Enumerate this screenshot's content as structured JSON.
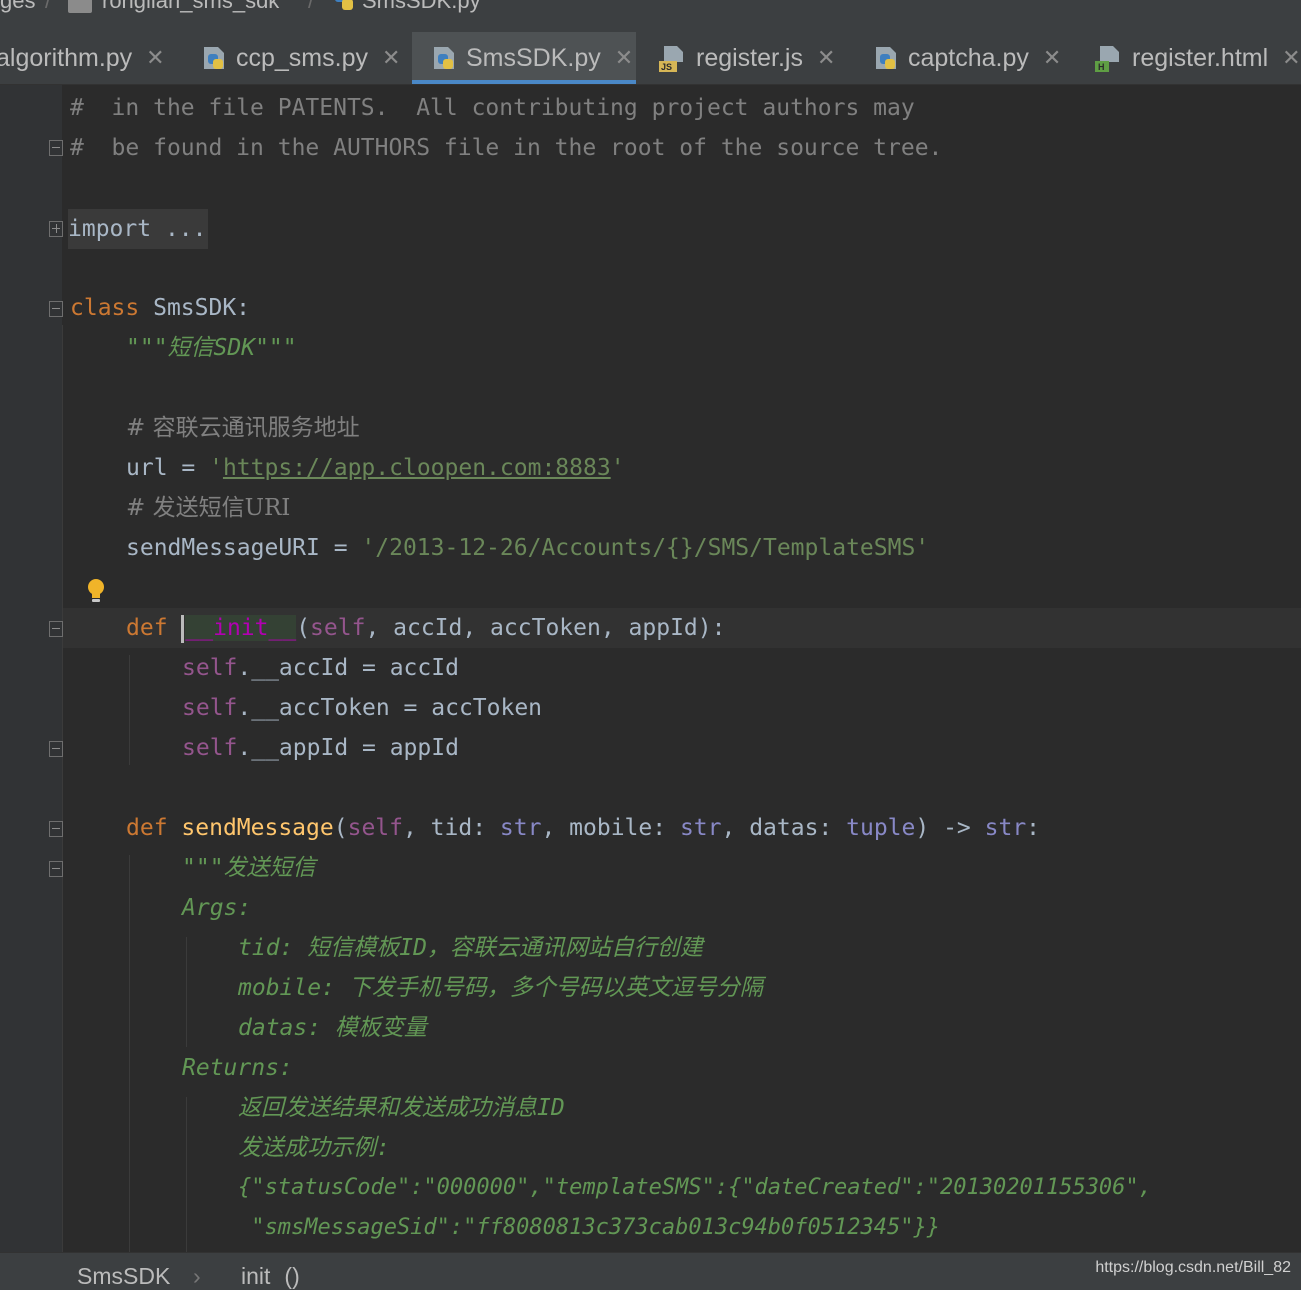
{
  "breadcrumb": {
    "items": [
      "ges",
      "ronglian_sms_sdk",
      "SmsSDK.py"
    ]
  },
  "tabs": [
    {
      "label": "algorithm.py",
      "icon": "python-file-icon",
      "active": false
    },
    {
      "label": "ccp_sms.py",
      "icon": "python-file-icon",
      "active": false
    },
    {
      "label": "SmsSDK.py",
      "icon": "python-file-icon",
      "active": true
    },
    {
      "label": "register.js",
      "icon": "javascript-file-icon",
      "active": false
    },
    {
      "label": "captcha.py",
      "icon": "python-file-icon",
      "active": false
    },
    {
      "label": "register.html",
      "icon": "html-file-icon",
      "active": false
    }
  ],
  "code": {
    "l1_hash": "#",
    "l1_text": "  in the file PATENTS.  All contributing project authors may",
    "l2_hash": "#",
    "l2_text": "  be found in the AUTHORS file in the root of the source tree.",
    "import_kw": "import",
    "import_dots": " ...",
    "class_kw": "class",
    "class_name": " SmsSDK:",
    "class_doc": "\"\"\"短信SDK\"\"\"",
    "comment_url": "# 容联云通讯服务地址",
    "url_name": "url",
    "url_eq": " = ",
    "url_q1": "'",
    "url_value": "https://app.cloopen.com:8883",
    "url_q2": "'",
    "comment_uri": "# 发送短信URI",
    "uri_name": "sendMessageURI",
    "uri_eq": " = ",
    "uri_value": "'/2013-12-26/Accounts/{}/SMS/TemplateSMS'",
    "def_kw": "def",
    "init_name": "__init__",
    "init_open": "(",
    "init_self": "self",
    "init_params": ", accId, accToken, appId):",
    "self1": "self",
    "assign1": ".__accId = accId",
    "self2": "self",
    "assign2": ".__accToken = accToken",
    "self3": "self",
    "assign3": ".__appId = appId",
    "def2_kw": "def",
    "send_name": "sendMessage",
    "send_open": "(",
    "send_self": "self",
    "send_p1": ", tid: ",
    "send_t1": "str",
    "send_p2": ", mobile: ",
    "send_t2": "str",
    "send_p3": ", datas: ",
    "send_t3": "tuple",
    "send_arrow": ") -> ",
    "send_t4": "str",
    "send_colon": ":",
    "doc1": "\"\"\"发送短信",
    "doc2": "Args:",
    "doc3": "tid: 短信模板ID，容联云通讯网站自行创建",
    "doc4": "mobile: 下发手机号码，多个号码以英文逗号分隔",
    "doc5": "datas: 模板变量",
    "doc6": "Returns:",
    "doc7": "返回发送结果和发送成功消息ID",
    "doc8": "发送成功示例:",
    "doc9": "{\"statusCode\":\"000000\",\"templateSMS\":{\"dateCreated\":\"20130201155306\",",
    "doc10": " \"smsMessageSid\":\"ff8080813c373cab013c94b0f0512345\"}}"
  },
  "bottom_breadcrumb": {
    "class_label": "SmsSDK",
    "method_label": "init",
    "method_parens": "()"
  },
  "watermark": "https://blog.csdn.net/Bill_82",
  "colors": {
    "background": "#2b2b2b",
    "keyword": "#cc7832",
    "string": "#6a8759",
    "docstring": "#629755",
    "self": "#94558d",
    "builtin": "#8888c6",
    "function": "#ffc66d",
    "accent_tab": "#4a88c7"
  }
}
